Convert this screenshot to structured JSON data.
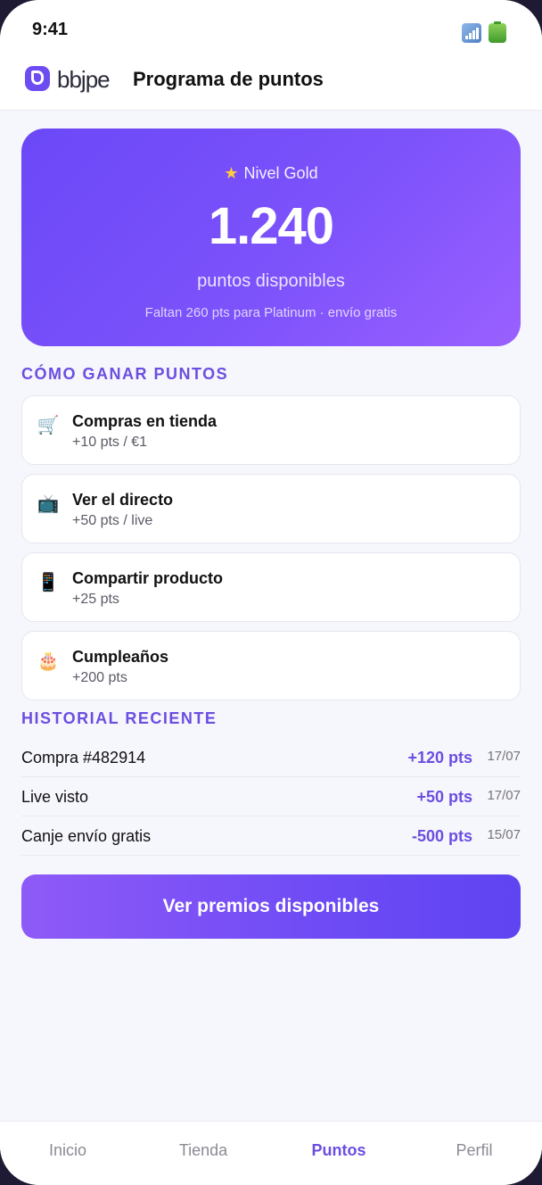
{
  "status": {
    "time": "9:41"
  },
  "header": {
    "logo": "bbjpe",
    "title": "Programa de puntos"
  },
  "points_card": {
    "level": "Nivel Gold",
    "points": "1.240",
    "points_label": "puntos disponibles",
    "note": "Faltan 260 pts para Platinum · envío gratis"
  },
  "earn": {
    "heading": "CÓMO GANAR PUNTOS",
    "items": [
      {
        "icon": "🛒",
        "title": "Compras en tienda",
        "sub": "+10 pts / €1"
      },
      {
        "icon": "📺",
        "title": "Ver el directo",
        "sub": "+50 pts / live"
      },
      {
        "icon": "📱",
        "title": "Compartir producto",
        "sub": "+25 pts"
      },
      {
        "icon": "🎂",
        "title": "Cumpleaños",
        "sub": "+200 pts"
      }
    ]
  },
  "history": {
    "heading": "HISTORIAL RECIENTE",
    "rows": [
      {
        "label": "Compra #482914",
        "points": "+120 pts",
        "date": "17/07"
      },
      {
        "label": "Live visto",
        "points": "+50 pts",
        "date": "17/07"
      },
      {
        "label": "Canje envío gratis",
        "points": "-500 pts",
        "date": "15/07"
      }
    ]
  },
  "cta": {
    "label": "Ver premios disponibles"
  },
  "tabs": [
    {
      "label": "Inicio"
    },
    {
      "label": "Tienda"
    },
    {
      "label": "Puntos"
    },
    {
      "label": "Perfil"
    }
  ],
  "colors": {
    "accent": "#6c4ee0",
    "card_start": "#6b48f7",
    "card_end": "#9a60ff"
  }
}
